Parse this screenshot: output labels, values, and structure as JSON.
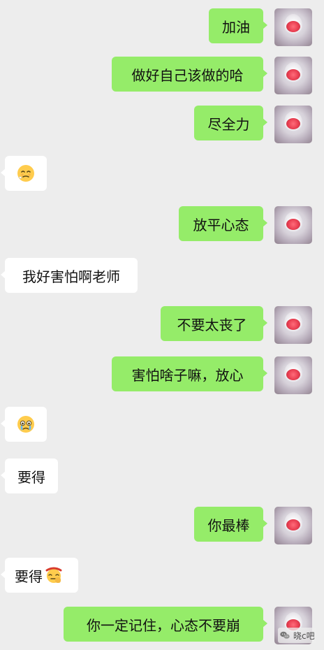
{
  "messages": [
    {
      "direction": "sent",
      "text": "加油"
    },
    {
      "direction": "sent",
      "text": "做好自己该做的哈"
    },
    {
      "direction": "sent",
      "text": "尽全力"
    },
    {
      "direction": "received",
      "text": "",
      "emoji": "sad-shy-emoji"
    },
    {
      "direction": "sent",
      "text": "放平心态"
    },
    {
      "direction": "received",
      "text": "我好害怕啊老师"
    },
    {
      "direction": "sent",
      "text": "不要太丧了"
    },
    {
      "direction": "sent",
      "text": "害怕啥子嘛，放心"
    },
    {
      "direction": "received",
      "text": "",
      "emoji": "tearful-emoji"
    },
    {
      "direction": "received",
      "text": "要得"
    },
    {
      "direction": "sent",
      "text": "你最棒"
    },
    {
      "direction": "received",
      "text": "要得",
      "emoji": "determined-emoji"
    },
    {
      "direction": "sent",
      "text": "你一定记住，心态不要崩"
    }
  ],
  "watermark": {
    "text": "晓c吧",
    "icon": "wechat-icon"
  },
  "colors": {
    "background": "#ededed",
    "sent_bubble": "#95ec69",
    "received_bubble": "#ffffff"
  }
}
